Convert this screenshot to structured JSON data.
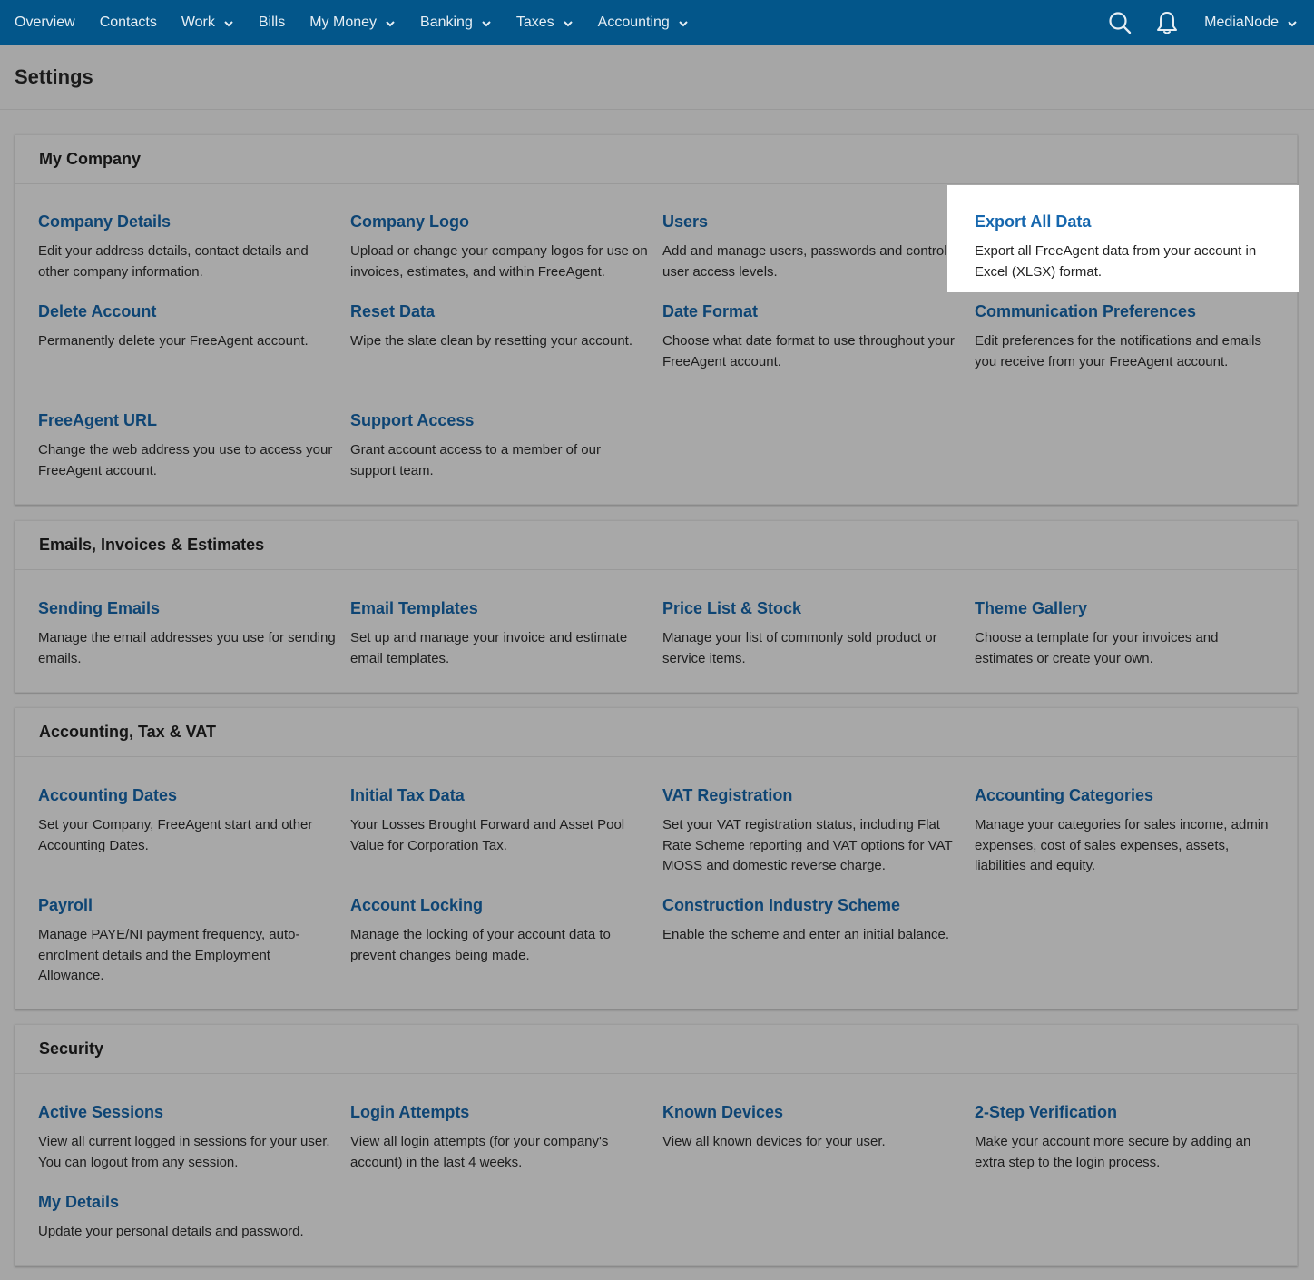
{
  "nav": {
    "items": [
      {
        "label": "Overview",
        "dropdown": false
      },
      {
        "label": "Contacts",
        "dropdown": false
      },
      {
        "label": "Work",
        "dropdown": true
      },
      {
        "label": "Bills",
        "dropdown": false
      },
      {
        "label": "My Money",
        "dropdown": true
      },
      {
        "label": "Banking",
        "dropdown": true
      },
      {
        "label": "Taxes",
        "dropdown": true
      },
      {
        "label": "Accounting",
        "dropdown": true
      }
    ],
    "account_label": "MediaNode",
    "icons": {
      "search": "search-icon",
      "notifications": "bell-icon"
    }
  },
  "page": {
    "title": "Settings"
  },
  "colors": {
    "nav_bg": "#03568a",
    "link": "#0e4574",
    "link_highlighted": "#1667ae",
    "highlight_bg": "#ffffff"
  },
  "sections": [
    {
      "title": "My Company",
      "items": [
        {
          "title": "Company Details",
          "desc": "Edit your address details, contact details and other company information."
        },
        {
          "title": "Company Logo",
          "desc": "Upload or change your company logos for use on invoices, estimates, and within FreeAgent."
        },
        {
          "title": "Users",
          "desc": "Add and manage users, passwords and control user access levels."
        },
        {
          "title": "Export All Data",
          "desc": "Export all FreeAgent data from your account in Excel (XLSX) format.",
          "highlighted": true
        },
        {
          "title": "Delete Account",
          "desc": "Permanently delete your FreeAgent account."
        },
        {
          "title": "Reset Data",
          "desc": "Wipe the slate clean by resetting your account."
        },
        {
          "title": "Date Format",
          "desc": "Choose what date format to use throughout your FreeAgent account."
        },
        {
          "title": "Communication Preferences",
          "desc": "Edit preferences for the notifications and emails you receive from your FreeAgent account."
        },
        {
          "title": "FreeAgent URL",
          "desc": "Change the web address you use to access your FreeAgent account."
        },
        {
          "title": "Support Access",
          "desc": "Grant account access to a member of our support team."
        }
      ]
    },
    {
      "title": "Emails, Invoices & Estimates",
      "items": [
        {
          "title": "Sending Emails",
          "desc": "Manage the email addresses you use for sending emails."
        },
        {
          "title": "Email Templates",
          "desc": "Set up and manage your invoice and estimate email templates."
        },
        {
          "title": "Price List & Stock",
          "desc": "Manage your list of commonly sold product or service items."
        },
        {
          "title": "Theme Gallery",
          "desc": "Choose a template for your invoices and estimates or create your own."
        }
      ]
    },
    {
      "title": "Accounting, Tax & VAT",
      "items": [
        {
          "title": "Accounting Dates",
          "desc": "Set your Company, FreeAgent start and other Accounting Dates."
        },
        {
          "title": "Initial Tax Data",
          "desc": "Your Losses Brought Forward and Asset Pool Value for Corporation Tax."
        },
        {
          "title": "VAT Registration",
          "desc": "Set your VAT registration status, including Flat Rate Scheme reporting and VAT options for VAT MOSS and domestic reverse charge."
        },
        {
          "title": "Accounting Categories",
          "desc": "Manage your categories for sales income, admin expenses, cost of sales expenses, assets, liabilities and equity."
        },
        {
          "title": "Payroll",
          "desc": "Manage PAYE/NI payment frequency, auto-enrolment details and the Employment Allowance."
        },
        {
          "title": "Account Locking",
          "desc": "Manage the locking of your account data to prevent changes being made."
        },
        {
          "title": "Construction Industry Scheme",
          "desc": "Enable the scheme and enter an initial balance."
        }
      ]
    },
    {
      "title": "Security",
      "items": [
        {
          "title": "Active Sessions",
          "desc": "View all current logged in sessions for your user. You can logout from any session."
        },
        {
          "title": "Login Attempts",
          "desc": "View all login attempts (for your company's account) in the last 4 weeks."
        },
        {
          "title": "Known Devices",
          "desc": "View all known devices for your user."
        },
        {
          "title": "2-Step Verification",
          "desc": "Make your account more secure by adding an extra step to the login process."
        },
        {
          "title": "My Details",
          "desc": "Update your personal details and password."
        }
      ]
    }
  ]
}
